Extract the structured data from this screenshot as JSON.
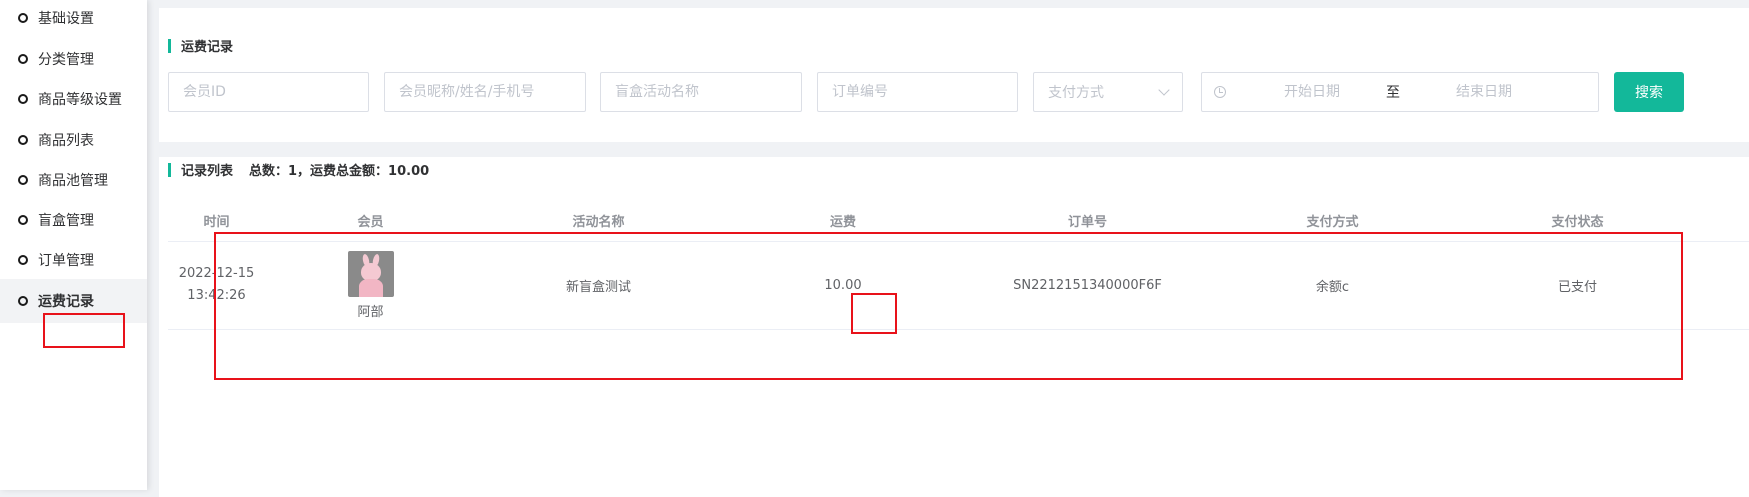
{
  "sidebar": {
    "items": [
      {
        "label": "基础设置"
      },
      {
        "label": "分类管理"
      },
      {
        "label": "商品等级设置"
      },
      {
        "label": "商品列表"
      },
      {
        "label": "商品池管理"
      },
      {
        "label": "盲盒管理"
      },
      {
        "label": "订单管理"
      },
      {
        "label": "运费记录"
      }
    ],
    "active_index": 7
  },
  "filters": {
    "title": "运费记录",
    "member_id_placeholder": "会员ID",
    "member_info_placeholder": "会员昵称/姓名/手机号",
    "activity_placeholder": "盲盒活动名称",
    "order_no_placeholder": "订单编号",
    "payment_method_placeholder": "支付方式",
    "start_date_placeholder": "开始日期",
    "date_separator": "至",
    "end_date_placeholder": "结束日期",
    "search_label": "搜索"
  },
  "records": {
    "title": "记录列表",
    "summary": "总数：1，运费总金额：10.00",
    "columns": [
      "时间",
      "会员",
      "活动名称",
      "运费",
      "订单号",
      "支付方式",
      "支付状态"
    ],
    "rows": [
      {
        "date": "2022-12-15",
        "time": "13:42:26",
        "member_name": "阿部",
        "activity": "新盲盒测试",
        "fee": "10.00",
        "order_no": "SN2212151340000F6F",
        "payment_method": "余额c",
        "payment_status": "已支付"
      }
    ]
  },
  "colors": {
    "accent": "#13b89a",
    "annotation": "#e8121a"
  }
}
